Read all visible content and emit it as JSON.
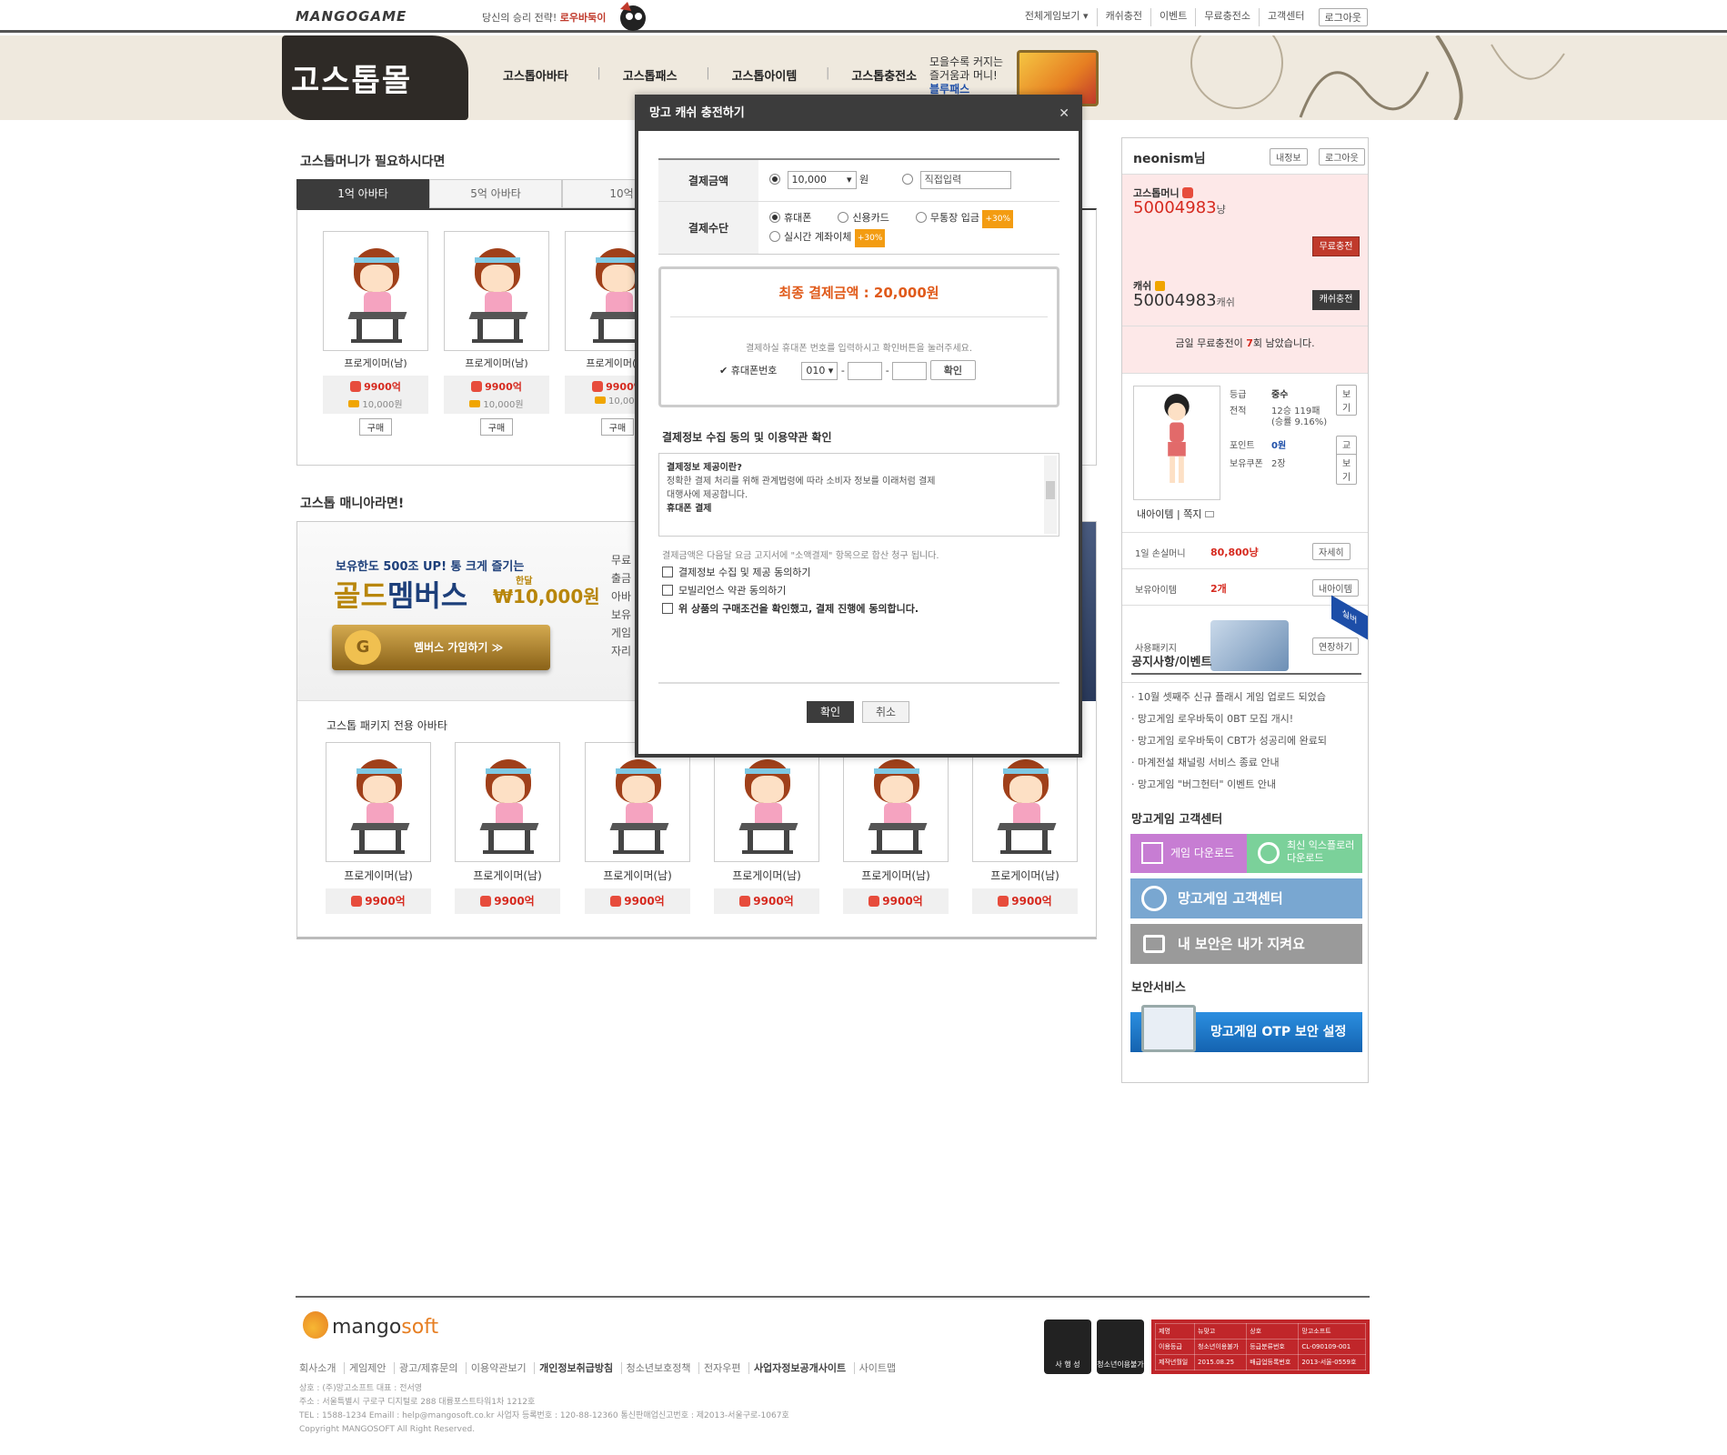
{
  "topbar": {
    "logo": "MANGOGAME",
    "promo_text": "당신의 승리 전략!",
    "promo_link": "로우바둑이",
    "nav": [
      "전체게임보기 ▾",
      "캐쉬충전",
      "이벤트",
      "무료충전소",
      "고객센터"
    ],
    "logout": "로그아웃"
  },
  "banner": {
    "title": "고스톱몰",
    "nav": [
      "고스톱아바타",
      "고스톱패스",
      "고스톱아이템",
      "고스톱충전소"
    ],
    "ad_line1": "모을수록 커지는",
    "ad_line2": "즐거움과 머니!",
    "ad_line3": "블루패스"
  },
  "left": {
    "section1_title": "고스톱머니가 필요하시다면",
    "tabs": [
      "1억 아바타",
      "5억 아바타",
      "10억 아"
    ],
    "items": [
      {
        "name": "프로게이머(남)",
        "price": "9900억",
        "cash": "10,000원",
        "buy": "구매"
      },
      {
        "name": "프로게이머(남)",
        "price": "9900억",
        "cash": "10,000원",
        "buy": "구매"
      },
      {
        "name": "프로게이머(남)",
        "price": "9900억",
        "cash": "10,000",
        "buy": "구매"
      }
    ],
    "section2_title": "고스톱 매니아라면!",
    "gold": {
      "line1": "보유한도 500조 UP! 통 크게 즐기는",
      "line2_a": "골드",
      "line2_b": "멤버스",
      "price_label": "한달",
      "price": "₩10,000원",
      "join": "멤버스 가입하기 ≫",
      "list": [
        "무료",
        "출금",
        "아바",
        "보유",
        "게임",
        "자리"
      ]
    },
    "pkg_title": "고스톱 패키지 전용 아바타",
    "pkg_items": [
      {
        "name": "프로게이머(남)",
        "price": "9900억"
      },
      {
        "name": "프로게이머(남)",
        "price": "9900억"
      },
      {
        "name": "프로게이머(남)",
        "price": "9900억"
      },
      {
        "name": "프로게이머(남)",
        "price": "9900억"
      },
      {
        "name": "프로게이머(남)",
        "price": "9900억"
      },
      {
        "name": "프로게이머(남)",
        "price": "9900억"
      }
    ]
  },
  "right": {
    "user": "neonism님",
    "btn_info": "내정보",
    "btn_logout": "로그아웃",
    "gostop_money_label": "고스톱머니",
    "gostop_money": "50004983",
    "gostop_unit": "냥",
    "free_charge": "무료충전",
    "cash_label": "캐쉬",
    "cash": "50004983",
    "cash_unit": "캐쉬",
    "cash_charge": "캐쉬충전",
    "note_a": "금일 무료충전이",
    "note_count": "7",
    "note_b": "회 남았습니다.",
    "grade_label": "등급",
    "grade": "중수",
    "record_label": "전적",
    "record": "12승 119패",
    "winrate": "(승률 9.16%)",
    "point_label": "포인트",
    "point": "0원",
    "coupon_label": "보유쿠폰",
    "coupon": "2장",
    "view": "보기",
    "exchange": "교환",
    "my_items": "내아이템",
    "memo": "쪽지",
    "loss_label": "1일 손실머니",
    "loss": "80,800냥",
    "detail": "자세히",
    "items_label": "보유아이템",
    "items_count": "2개",
    "my_items_btn": "내아이템",
    "pkg_label": "사용패키지",
    "extend": "연장하기",
    "ribbon": "실버",
    "notice_title": "공지사항/이벤트",
    "notices": [
      "· 10월 셋째주 신규 플래시 게임 업로드 되었습",
      "· 망고게임 로우바둑이 0BT 모집 개시!",
      "· 망고게임 로우바둑이 CBT가 성공리에 완료되",
      "· 마계전설 채널링 서비스 종료 안내",
      "· 망고게임 \"버그헌터\" 이벤트 안내"
    ],
    "cs_title": "망고게임 고객센터",
    "download": "게임 다운로드",
    "explorer": "최신 익스플로러 다운로드",
    "cs_center": "망고게임 고객센터",
    "security_msg": "내 보안은 내가 지켜요",
    "sec_title": "보안서비스",
    "otp": "망고게임 OTP 보안 설정"
  },
  "footer": {
    "logo_a": "mango",
    "logo_b": "soft",
    "links": [
      "회사소개",
      "게임제안",
      "광고/제휴문의",
      "이용약관보기",
      "개인정보취급방침",
      "청소년보호정책",
      "전자우편",
      "사업자정보공개사이트",
      "사이트맵"
    ],
    "info1": "상호 : (주)망고소프트 대표 : 전서영",
    "info2": "주소 : 서울특별시 구로구 디지털로 288 대륭포스트타워1차 1212호",
    "info3": "TEL : 1588-1234 Emaill : help@mangosoft.co.kr 사업자 등록번호 : 120-88-12360 통신판매업신고번호 : 제2013-서울구로-1067호",
    "info4": "Copyright MANGOSOFT All Right Reserved.",
    "badge1": "사 행 성",
    "badge2": "청소년이용불가",
    "rating": [
      [
        "제명",
        "뉴맞고",
        "상호",
        "망고소프트"
      ],
      [
        "이용등급",
        "청소년이용불가",
        "등급분류번호",
        "CL-090109-001"
      ],
      [
        "제작년월일",
        "2015.08.25",
        "배급업등록번호",
        "2013-서울-0559호"
      ]
    ]
  },
  "modal": {
    "title": "망고 캐쉬 충전하기",
    "close": "✕",
    "amount_label": "결제금액",
    "amount_value": "10,000",
    "amount_unit": "원",
    "direct_input": "직접입력",
    "method_label": "결제수단",
    "methods": [
      "휴대폰",
      "신용카드",
      "무통장 입금",
      "실시간 계좌이체"
    ],
    "bonus": "+30%",
    "total": "최종 결제금액 : 20,000원",
    "guide": "결제하실 휴대폰 번호를 입력하시고 확인버튼을 눌러주세요.",
    "phone_label": "✔ 휴대폰번호",
    "phone_prefix": "010",
    "confirm_small": "확인",
    "agree_title": "결제정보 수집 동의 및 이용약관 확인",
    "agree_h1": "결제정보 제공이란?",
    "agree_p1": "정확한 결제 처리를 위해 관계법령에 따라 소비자 정보를 이래처럼 결제",
    "agree_p2": "대행사에 제공합니다.",
    "agree_h2": "휴대폰 결제",
    "agree_note": "결제금액은 다음달 요금 고지서에 \"소액결제\" 항목으로 합산 청구 됩니다.",
    "checks": [
      "결제정보 수집 및 제공 동의하기",
      "모빌리언스 약관 동의하기",
      "위 상품의 구매조건을 확인했고, 결제 진행에 동의합니다."
    ],
    "ok": "확인",
    "cancel": "취소"
  }
}
